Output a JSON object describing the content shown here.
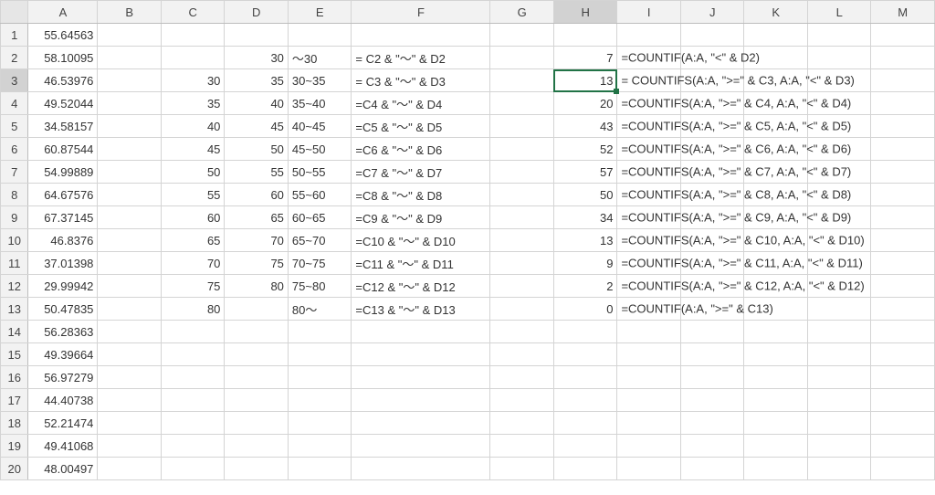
{
  "columns": [
    "A",
    "B",
    "C",
    "D",
    "E",
    "F",
    "G",
    "H",
    "I",
    "J",
    "K",
    "L",
    "M"
  ],
  "active": {
    "col": "H",
    "row": 3
  },
  "rows": [
    {
      "n": 1,
      "A": "55.64563"
    },
    {
      "n": 2,
      "A": "58.10095",
      "D": "30",
      "E": "～30",
      "F": "= C2 & \"～\" & D2",
      "H": "7",
      "I": "=COUNTIF(A:A, \"<\" & D2)"
    },
    {
      "n": 3,
      "A": "46.53976",
      "C": "30",
      "D": "35",
      "E": "30~35",
      "F": "= C3 & \"～\" & D3",
      "H": "13",
      "I": "= COUNTIFS(A:A, \">=\" & C3, A:A, \"<\" & D3)"
    },
    {
      "n": 4,
      "A": "49.52044",
      "C": "35",
      "D": "40",
      "E": "35~40",
      "F": "=C4 & \"～\" & D4",
      "H": "20",
      "I": "=COUNTIFS(A:A, \">=\" & C4, A:A, \"<\" & D4)"
    },
    {
      "n": 5,
      "A": "34.58157",
      "C": "40",
      "D": "45",
      "E": "40~45",
      "F": "=C5 & \"～\" & D5",
      "H": "43",
      "I": "=COUNTIFS(A:A, \">=\" & C5, A:A, \"<\" & D5)"
    },
    {
      "n": 6,
      "A": "60.87544",
      "C": "45",
      "D": "50",
      "E": "45~50",
      "F": "=C6 & \"～\" & D6",
      "H": "52",
      "I": "=COUNTIFS(A:A, \">=\" & C6, A:A, \"<\" & D6)"
    },
    {
      "n": 7,
      "A": "54.99889",
      "C": "50",
      "D": "55",
      "E": "50~55",
      "F": "=C7 & \"～\" & D7",
      "H": "57",
      "I": "=COUNTIFS(A:A, \">=\" & C7, A:A, \"<\" & D7)"
    },
    {
      "n": 8,
      "A": "64.67576",
      "C": "55",
      "D": "60",
      "E": "55~60",
      "F": "=C8 & \"～\" & D8",
      "H": "50",
      "I": "=COUNTIFS(A:A, \">=\" & C8, A:A, \"<\" & D8)"
    },
    {
      "n": 9,
      "A": "67.37145",
      "C": "60",
      "D": "65",
      "E": "60~65",
      "F": "=C9 & \"～\" & D9",
      "H": "34",
      "I": "=COUNTIFS(A:A, \">=\" & C9, A:A, \"<\" & D9)"
    },
    {
      "n": 10,
      "A": "46.8376",
      "C": "65",
      "D": "70",
      "E": "65~70",
      "F": "=C10 & \"～\" & D10",
      "H": "13",
      "I": "=COUNTIFS(A:A, \">=\" & C10, A:A, \"<\" & D10)"
    },
    {
      "n": 11,
      "A": "37.01398",
      "C": "70",
      "D": "75",
      "E": "70~75",
      "F": "=C11 & \"～\" & D11",
      "H": "9",
      "I": "=COUNTIFS(A:A, \">=\" & C11, A:A, \"<\" & D11)"
    },
    {
      "n": 12,
      "A": "29.99942",
      "C": "75",
      "D": "80",
      "E": "75~80",
      "F": "=C12 & \"～\" & D12",
      "H": "2",
      "I": "=COUNTIFS(A:A, \">=\" & C12, A:A, \"<\" & D12)"
    },
    {
      "n": 13,
      "A": "50.47835",
      "C": "80",
      "E": "80～",
      "F": "=C13 & \"～\" & D13",
      "H": "0",
      "I": "=COUNTIF(A:A, \">=\" & C13)"
    },
    {
      "n": 14,
      "A": "56.28363"
    },
    {
      "n": 15,
      "A": "49.39664"
    },
    {
      "n": 16,
      "A": "56.97279"
    },
    {
      "n": 17,
      "A": "44.40738"
    },
    {
      "n": 18,
      "A": "52.21474"
    },
    {
      "n": 19,
      "A": "49.41068"
    },
    {
      "n": 20,
      "A": "48.00497"
    }
  ]
}
